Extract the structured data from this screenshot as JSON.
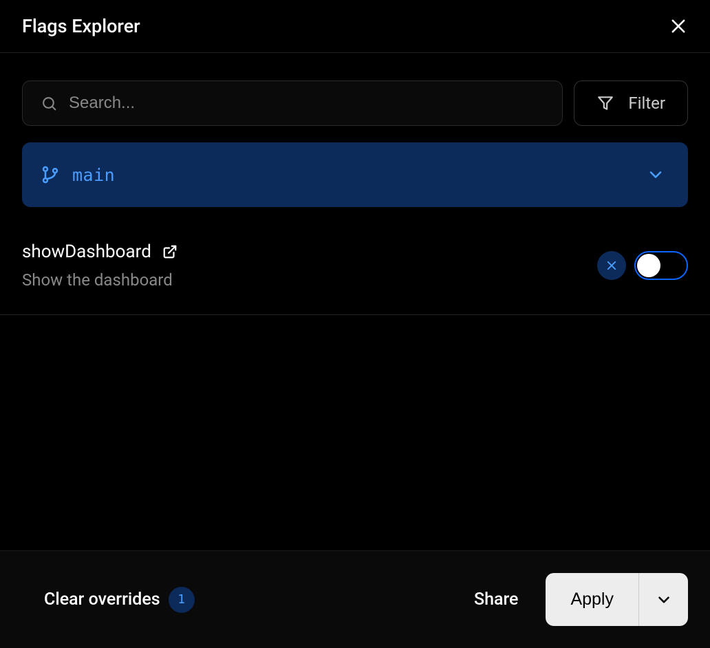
{
  "header": {
    "title": "Flags Explorer"
  },
  "controls": {
    "search": {
      "placeholder": "Search...",
      "value": ""
    },
    "filter_label": "Filter"
  },
  "branch": {
    "name": "main"
  },
  "flags": [
    {
      "name": "showDashboard",
      "description": "Show the dashboard",
      "enabled": true,
      "overridden": true
    }
  ],
  "footer": {
    "clear_label": "Clear overrides",
    "override_count": "1",
    "share_label": "Share",
    "apply_label": "Apply"
  }
}
